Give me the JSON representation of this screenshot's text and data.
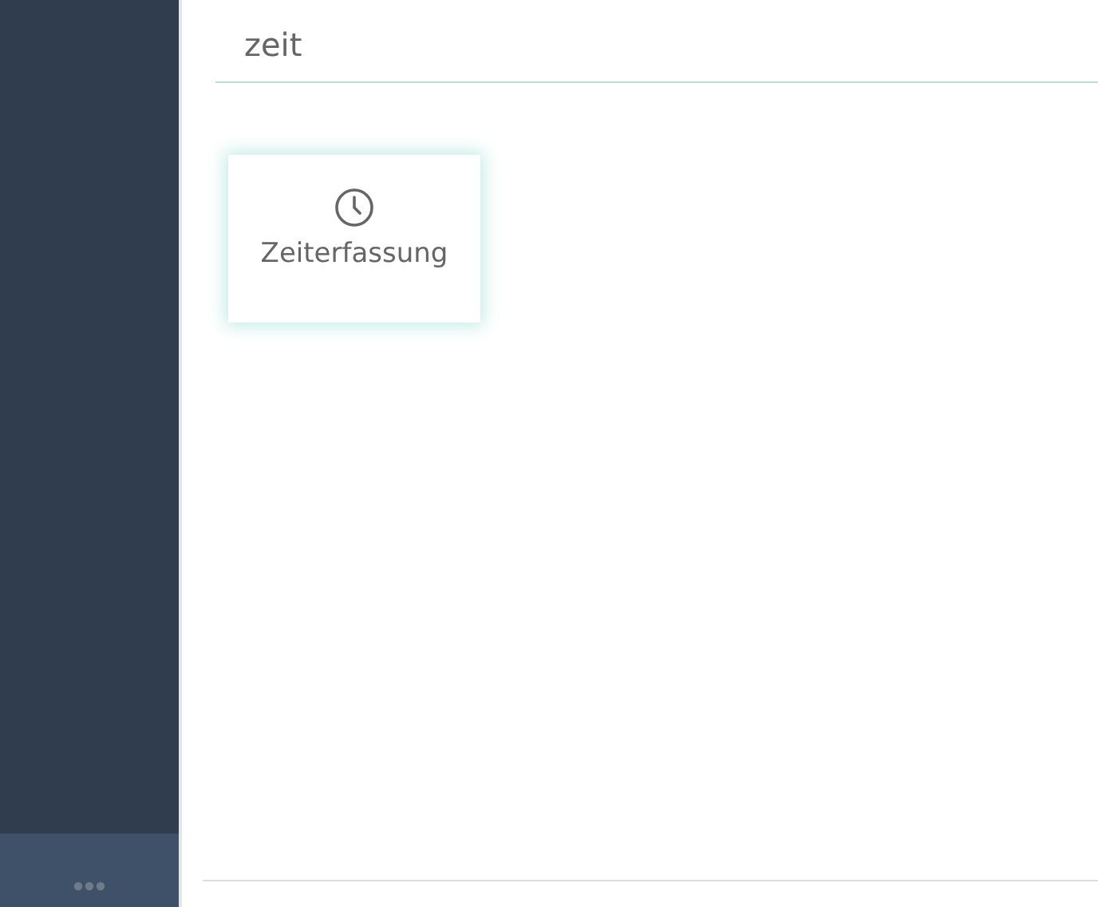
{
  "search": {
    "value": "zeit"
  },
  "results": [
    {
      "label": "Zeiterfassung",
      "selected": true
    }
  ]
}
